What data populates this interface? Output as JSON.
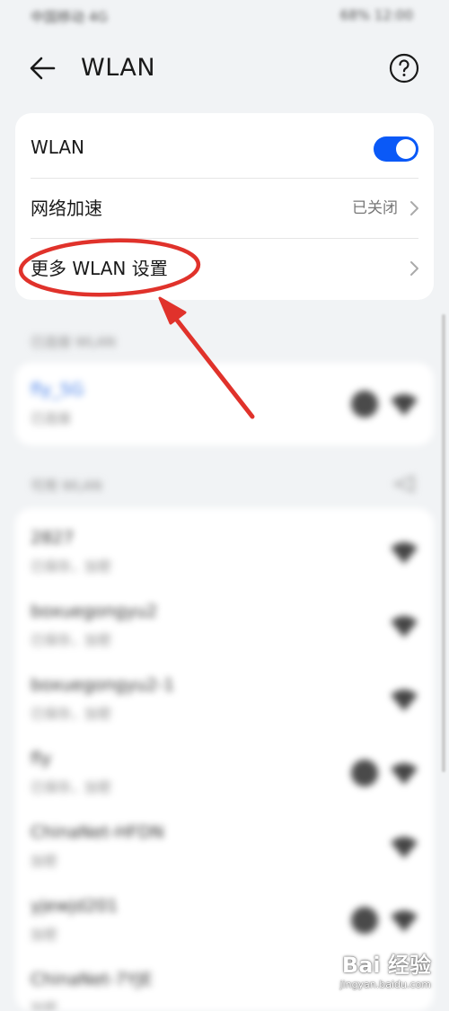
{
  "status_bar": {
    "carrier": "中国移动 4G",
    "right": "68% 12:00"
  },
  "header": {
    "title": "WLAN"
  },
  "settings": {
    "wlan_label": "WLAN",
    "wlan_enabled": true,
    "accel_label": "网络加速",
    "accel_value": "已关闭",
    "more_label": "更多 WLAN 设置"
  },
  "connected": {
    "section_label": "已连接 WLAN",
    "ssid": "fly_5G",
    "status": "已连接"
  },
  "available": {
    "section_label": "可用 WLAN",
    "networks": [
      {
        "ssid": "2827",
        "status": "已保存，加密"
      },
      {
        "ssid": "boxuegongyu2",
        "status": "已保存，加密"
      },
      {
        "ssid": "boxuegongyu2-1",
        "status": "已保存，加密"
      },
      {
        "ssid": "fly",
        "status": "已保存，加密"
      },
      {
        "ssid": "ChinaNet-HFDN",
        "status": "加密"
      },
      {
        "ssid": "yjewjd201",
        "status": "加密"
      },
      {
        "ssid": "ChinaNet-7YJE",
        "status": "加密"
      }
    ]
  },
  "watermark": {
    "main": "Bai 经验",
    "sub": "jingyan.baidu.com"
  },
  "colors": {
    "accent": "#0a59f7",
    "annotation": "#e0322b"
  }
}
